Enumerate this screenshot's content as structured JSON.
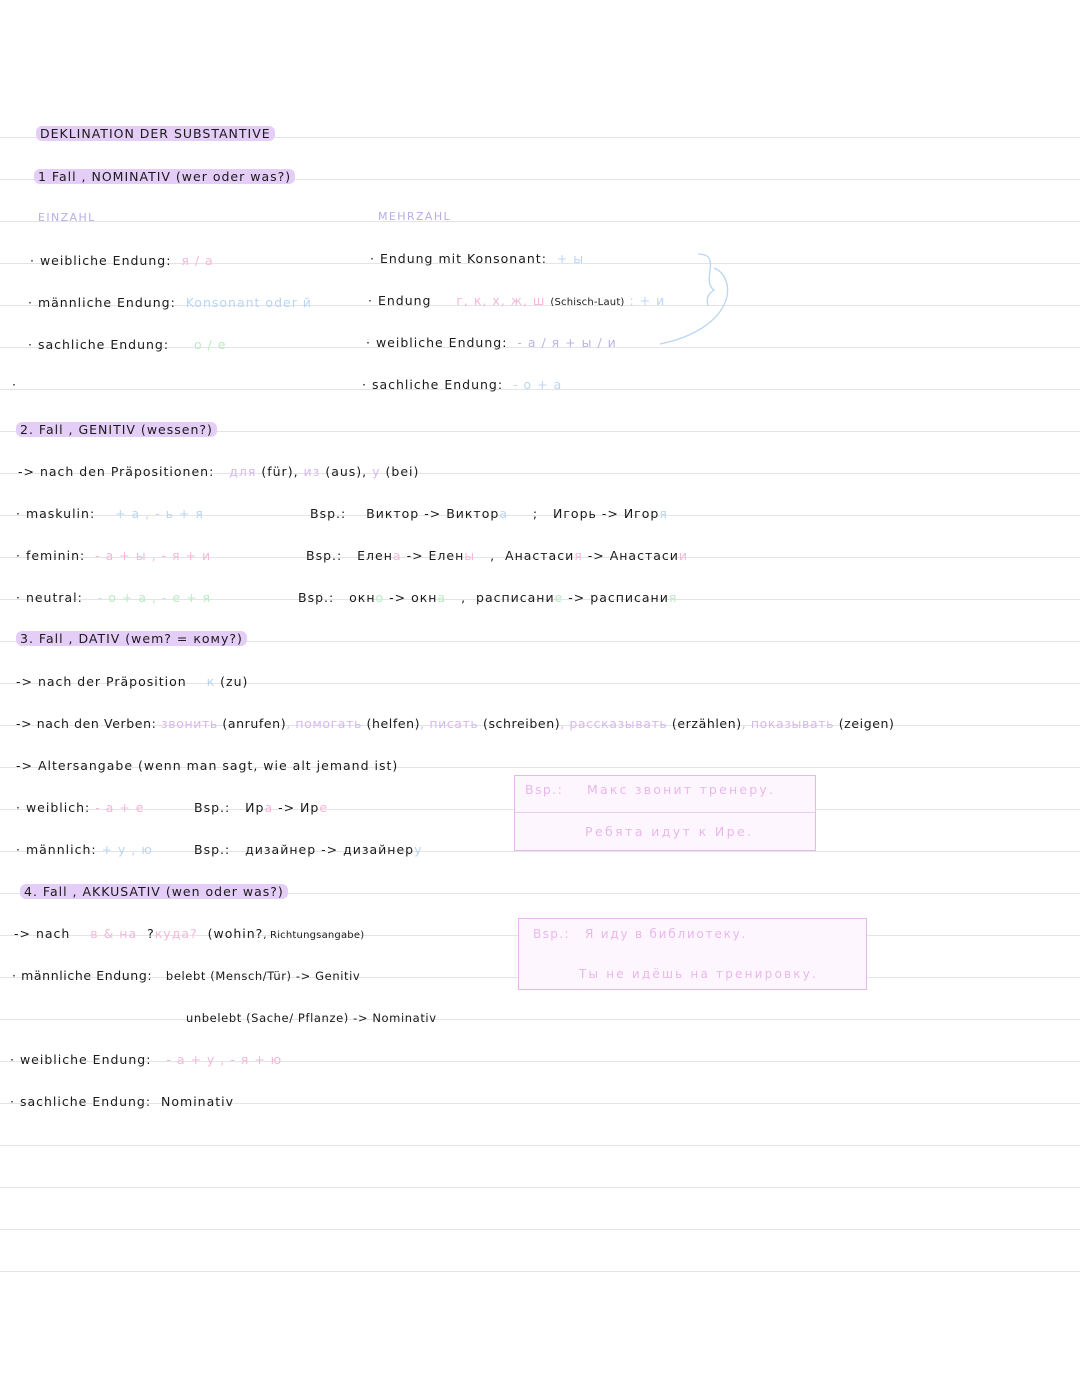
{
  "title": "DEKLINATION DER SUBSTANTIVE",
  "colors": {
    "highlight": "#e4cdf7",
    "pink": "#f4b8d8",
    "blue": "#b9d6f3",
    "green": "#b9ecc3",
    "box_border": "#e6b9ec",
    "lavender": "#bcb3e6"
  },
  "nominativ": {
    "heading": "1 Fall , NOMINATIV (wer oder was?)",
    "einzahl": "EINZAHL",
    "mehrzahl": "MEHRZAHL",
    "left": [
      {
        "label": "· weibliche Endung:",
        "value": "я / а"
      },
      {
        "label": "· männliche Endung:",
        "value": "Konsonant oder й"
      },
      {
        "label": "· sachliche Endung:",
        "value": "о / е"
      }
    ],
    "right": [
      {
        "label": "· Endung mit Konsonant:",
        "value": "+ ы"
      },
      {
        "label": "· Endung",
        "value_pink": "г, к, х, ж, ш",
        "value_note": "(Schisch-Laut)",
        "value_blue": ": + и"
      },
      {
        "label": "· weibliche Endung:",
        "value": "- а / я + ы / и"
      },
      {
        "label": "· sachliche Endung:",
        "value": "- о + а"
      }
    ],
    "dot": "·"
  },
  "genitiv": {
    "heading": "2. Fall , GENITIV (wessen?)",
    "prep_line": {
      "prefix": "-> nach den Präpositionen:",
      "p1": "для",
      "t1": "(für),",
      "p2": "из",
      "t2": "(aus),",
      "p3": "у",
      "t3": "(bei)"
    },
    "rows": [
      {
        "label": "· maskulin:",
        "endings": "+ а , - ь + я",
        "bsp": "Bsp.:",
        "ex1a": "Виктор ->",
        "ex1b": "Виктор",
        "ex1c": "а",
        "sep": ";",
        "ex2a": "Игорь ->",
        "ex2b": "Игор",
        "ex2c": "я"
      },
      {
        "label": "· feminin:",
        "endings": "- а + ы , - я + и",
        "bsp": "Bsp.:",
        "ex1a": "Елен",
        "ex1e": "а",
        "ex1f": "-> Елен",
        "ex1c": "ы",
        "sep": ",",
        "ex2a": "Анастаси",
        "ex2e": "я",
        "ex2f": "-> Анастаси",
        "ex2c": "и"
      },
      {
        "label": "· neutral:",
        "endings": "- о + а , - е + я",
        "bsp": "Bsp.:",
        "ex1a": "окн",
        "ex1e": "о",
        "ex1f": "-> окн",
        "ex1c": "а",
        "sep": ",",
        "ex2a": "расписани",
        "ex2e": "е",
        "ex2f": "-> расписани",
        "ex2c": "я"
      }
    ]
  },
  "dativ": {
    "heading": "3. Fall , DATIV (wem? = кому?)",
    "prep_line": {
      "prefix": "-> nach der Präposition",
      "prep": "к",
      "tr": "(zu)"
    },
    "verbs_line": {
      "prefix": "-> nach den Verben:",
      "verbs": [
        {
          "ru": "звонить",
          "de": "(anrufen)"
        },
        {
          "ru": "помогать",
          "de": "(helfen)"
        },
        {
          "ru": "писать",
          "de": "(schreiben)"
        },
        {
          "ru": "рассказывать",
          "de": "(erzählen)"
        },
        {
          "ru": "показывать",
          "de": "(zeigen)"
        }
      ]
    },
    "age_line": "-> Altersangabe (wenn man sagt, wie alt jemand ist)",
    "weiblich": {
      "label": "· weiblich:",
      "endings": "- а + е",
      "bsp": "Bsp.:",
      "ex_a": "Ир",
      "ex_b": "а",
      "arrow": "-> Ир",
      "ex_c": "е"
    },
    "maennlich": {
      "label": "· männlich:",
      "endings": "+ у , ю",
      "bsp": "Bsp.:",
      "ex_a": "дизайнер",
      "arrow": "-> дизайнер",
      "ex_c": "у"
    },
    "box": {
      "bsp": "Bsp.:",
      "line1": "Макс звонит тренеру.",
      "line2": "Ребята идут к Ире."
    }
  },
  "akkusativ": {
    "heading": "4. Fall , AKKUSATIV (wen oder was?)",
    "prep_line": {
      "prefix": "-> nach",
      "preps": "в & на",
      "q_prefix": "?",
      "q": "куда?",
      "note": "(wohin?",
      "note_small": ", Richtungsangabe)"
    },
    "maennlich": {
      "label": "· männliche Endung:",
      "belebt": "belebt (Mensch/Tür) -> Genitiv",
      "unbelebt": "unbelebt (Sache/ Pflanze) -> Nominativ"
    },
    "weiblich": {
      "label": "· weibliche Endung:",
      "endings": "- а + у , - я + ю"
    },
    "sachlich": {
      "label": "· sachliche Endung:",
      "value": "Nominativ"
    },
    "box": {
      "bsp": "Bsp.:",
      "line1": "Я иду в библиотеку.",
      "line2": "Ты не идёшь на тренировку."
    }
  }
}
